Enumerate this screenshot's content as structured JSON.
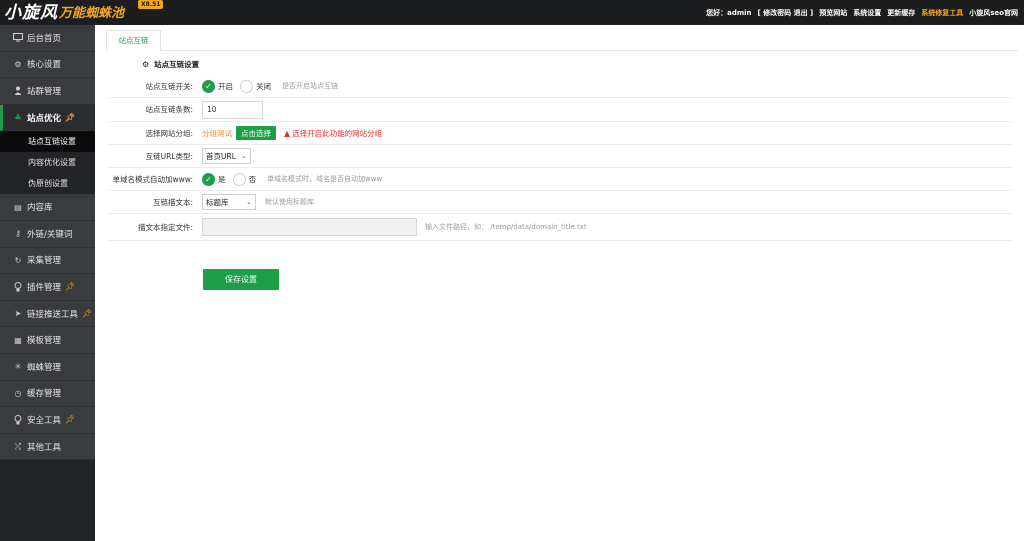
{
  "brand": {
    "logo_main": "小旋风",
    "logo_sub": "万能蜘蛛池",
    "version": "X8.51",
    "accent_color": "#1e9e49",
    "orange_color": "#f3a71c"
  },
  "topnav": {
    "greeting": "您好：admin",
    "account": "[ 修改密码 退出 ]",
    "preview": "预览网站",
    "settings": "系统设置",
    "update_cache": "更新缓存",
    "repair": "系统修复工具",
    "official": "小旋风seo官网"
  },
  "sidebar": {
    "items": [
      {
        "label": "后台首页",
        "icon": "monitor-icon"
      },
      {
        "label": "核心设置",
        "icon": "gear-icon"
      },
      {
        "label": "站群管理",
        "icon": "user-icon"
      },
      {
        "label": "站点优化",
        "icon": "leaf-icon"
      },
      {
        "label": "内容库",
        "icon": "book-icon"
      },
      {
        "label": "外链/关键词",
        "icon": "key-icon"
      },
      {
        "label": "采集管理",
        "icon": "refresh-icon"
      },
      {
        "label": "插件管理",
        "icon": "lightbulb-icon"
      },
      {
        "label": "链接推送工具",
        "icon": "send-icon"
      },
      {
        "label": "模板管理",
        "icon": "grid-icon"
      },
      {
        "label": "蜘蛛管理",
        "icon": "spider-icon"
      },
      {
        "label": "缓存管理",
        "icon": "clock-icon"
      },
      {
        "label": "安全工具",
        "icon": "shield-icon"
      },
      {
        "label": "其他工具",
        "icon": "shuffle-icon"
      }
    ],
    "subitems": [
      "站点互链设置",
      "内容优化设置",
      "伪原创设置"
    ]
  },
  "main": {
    "tab": "站点互链",
    "section_title": "站点互链设置",
    "rows": {
      "switch": {
        "label": "站点互链开关:",
        "on": "开启",
        "off": "关闭",
        "hint": "是否开启站点互链"
      },
      "count": {
        "label": "站点互链条数:",
        "value": "10"
      },
      "group": {
        "label": "选择网站分组:",
        "selected": "分组测试",
        "button": "点击选择",
        "warning": "选择开启此功能的网站分组"
      },
      "url_type": {
        "label": "互链URL类型:",
        "value": "首页URL"
      },
      "www": {
        "label": "单域名模式自动加www:",
        "yes": "是",
        "no": "否",
        "hint": "单域名模式时，域名是否自动加www"
      },
      "anchor": {
        "label": "互链描文本:",
        "value": "标题库",
        "hint": "默认使用标题库"
      },
      "anchor_file": {
        "label": "描文本指定文件:",
        "value": "",
        "hint": "输入文件路径，如：  /temp/data/domain_title.txt"
      }
    },
    "save": "保存设置"
  }
}
